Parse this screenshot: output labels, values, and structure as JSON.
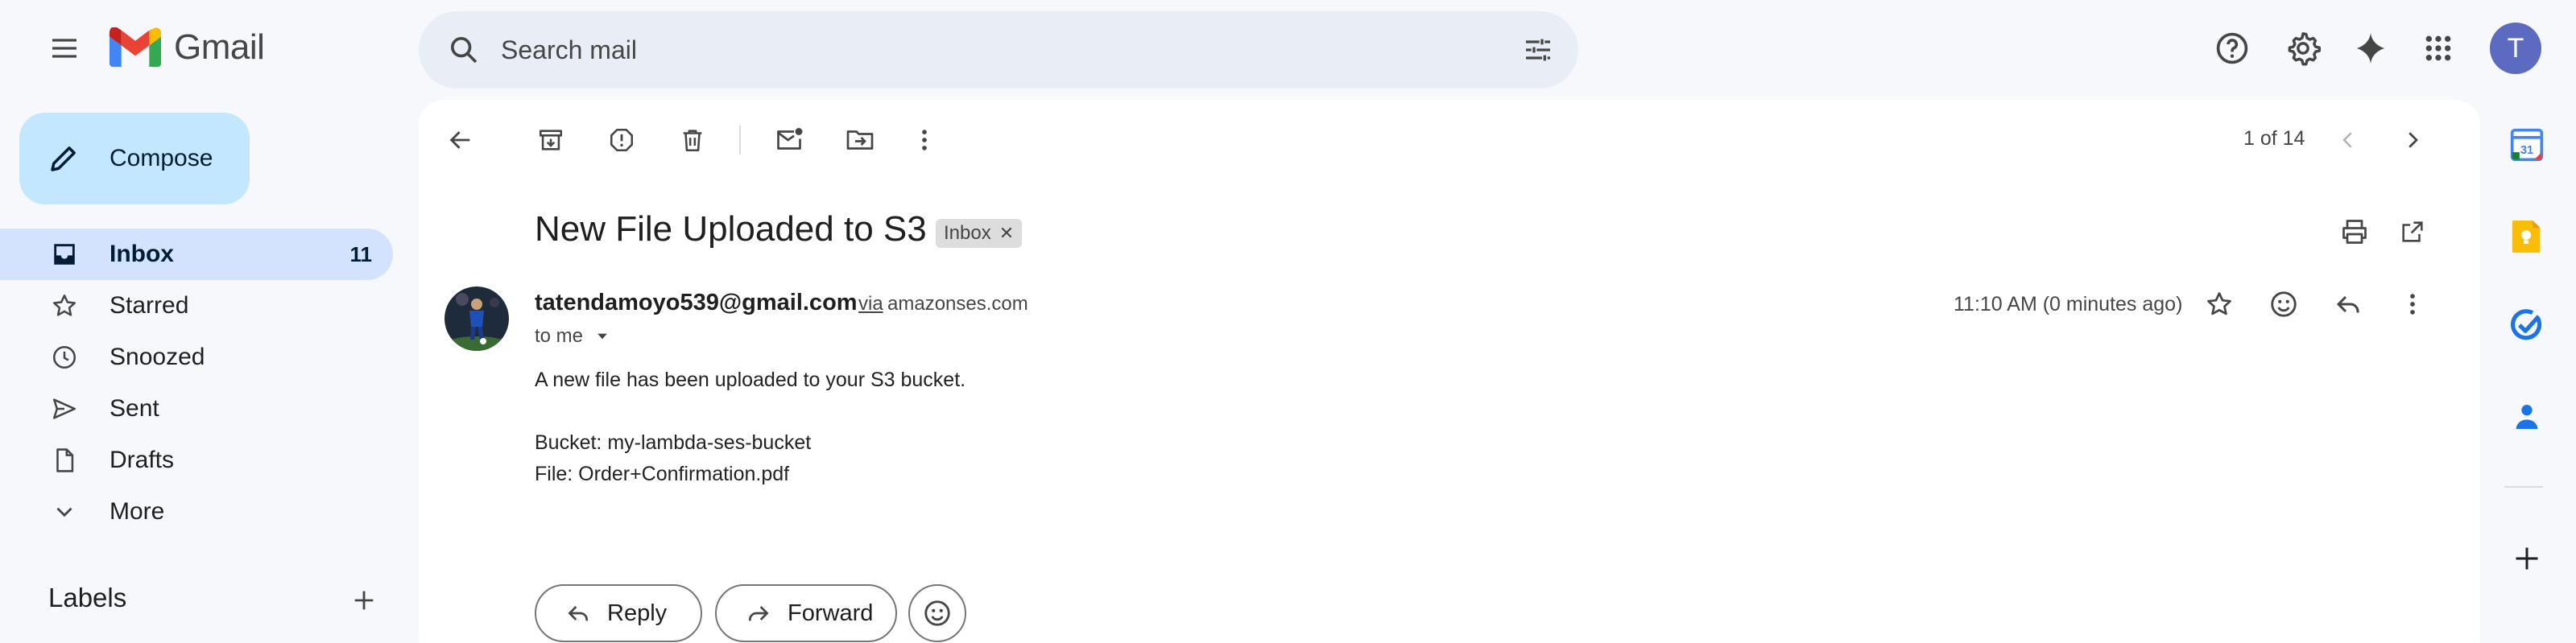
{
  "app": {
    "name": "Gmail"
  },
  "search": {
    "placeholder": "Search mail"
  },
  "account": {
    "initial": "T"
  },
  "compose": {
    "label": "Compose"
  },
  "nav": {
    "items": [
      {
        "label": "Inbox",
        "count": "11",
        "icon": "inbox-icon",
        "active": true
      },
      {
        "label": "Starred",
        "icon": "star-icon"
      },
      {
        "label": "Snoozed",
        "icon": "clock-icon"
      },
      {
        "label": "Sent",
        "icon": "send-icon"
      },
      {
        "label": "Drafts",
        "icon": "draft-icon"
      },
      {
        "label": "More",
        "icon": "chevron-down-icon"
      }
    ],
    "labels_heading": "Labels"
  },
  "toolbar": {
    "pager": "1 of 14"
  },
  "email": {
    "subject": "New File Uploaded to S3",
    "label_badge": "Inbox",
    "sender_email": "tatendamoyo539@gmail.com",
    "via_label": "via",
    "via_domain": "amazonses.com",
    "recipient": "to me",
    "timestamp": "11:10 AM (0 minutes ago)",
    "body": [
      "A new file has been uploaded to your S3 bucket.",
      "Bucket: my-lambda-ses-bucket",
      "File: Order+Confirmation.pdf"
    ]
  },
  "actions": {
    "reply": "Reply",
    "forward": "Forward"
  },
  "side_panel": {
    "apps": [
      "calendar-icon",
      "keep-icon",
      "tasks-icon",
      "contacts-icon",
      "add-icon"
    ],
    "calendar_day": "31"
  },
  "colors": {
    "background": "#f6f8fc",
    "compose": "#c2e7ff",
    "active_nav": "#d3e3fd",
    "search_bg": "#e9eef6",
    "avatar": "#5c6bc0"
  }
}
